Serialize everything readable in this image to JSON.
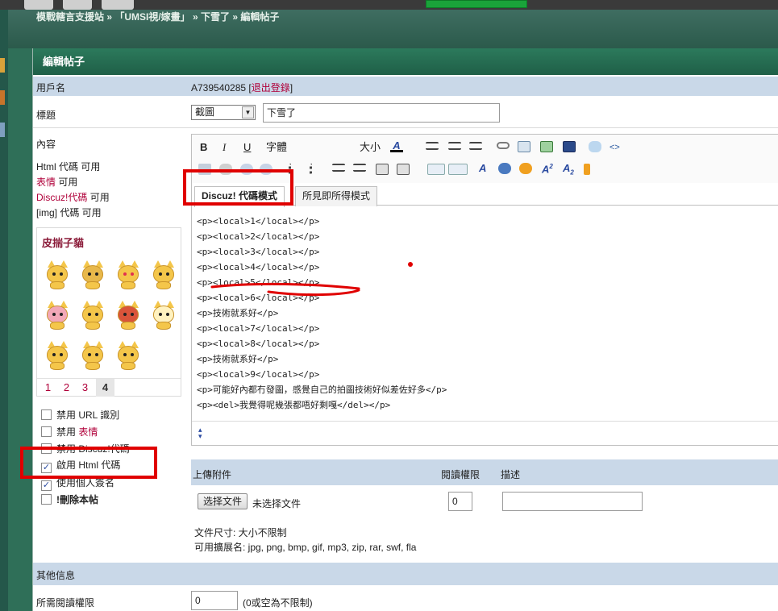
{
  "header": {
    "breadcrumb": "模戰轄言支援站 » 「UMSI視/嫁畫」 » 下雪了 » 編輯帖子"
  },
  "panel": {
    "title": "編輯帖子"
  },
  "form": {
    "username_label": "用戶名",
    "username_value": "A739540285",
    "logout_link": "退出登錄",
    "title_label": "標題",
    "title_prefix": "截圖",
    "title_value": "下雪了",
    "content_label": "內容",
    "html_status": "Html 代碼 可用",
    "smilies_link": "表情",
    "smilies_status": "可用",
    "discuz_link": "Discuz!代碼",
    "discuz_status": "可用",
    "img_status": "[img] 代碼 可用"
  },
  "emoticons": {
    "title": "皮揣子貓",
    "pages": [
      "1",
      "2",
      "3",
      "4"
    ],
    "current_page": "4"
  },
  "options": {
    "disable_url": "禁用 URL 識別",
    "disable_smilies_prefix": "禁用",
    "disable_smilies_link": "表情",
    "disable_discuz": "禁用 Discuz!代碼",
    "enable_html": "啟用 Html 代碼",
    "use_signature": "使用個人簽名",
    "delete_post": "!刪除本帖"
  },
  "editor": {
    "bold": "B",
    "italic": "I",
    "underline": "U",
    "font": "字體",
    "size": "大小",
    "font_color_glyph": "A",
    "tab_code": "Discuz! 代碼模式",
    "tab_wysiwyg": "所見即所得模式",
    "lines": [
      "<p><local>1</local></p>",
      "<p><local>2</local></p>",
      "<p><local>3</local></p>",
      "<p><local>4</local></p>",
      "<p><local>5</local></p>",
      "<p><local>6</local></p>",
      "<p>技術就系好</p>",
      "<p><local>7</local></p>",
      "<p><local>8</local></p>",
      "<p>技術就系好</p>",
      "<p><local>9</local></p>",
      "<p>可能好內都冇發圖，感覺自己的拍圖技術好似差佐好多</p>",
      "<p><del>我覺得呢幾張都唔好剩嘎</del></p>"
    ]
  },
  "upload": {
    "header_attach": "上傳附件",
    "header_permission": "閱讀權限",
    "header_desc": "描述",
    "choose_file": "选择文件",
    "no_file": "未选择文件",
    "permission_value": "0",
    "size_note": "文件尺寸: 大小不限制",
    "ext_note": "可用擴展名: jpg, png, bmp, gif, mp3, zip, rar, swf, fla"
  },
  "other": {
    "section_title": "其他信息",
    "read_perm_label": "所需閱讀權限",
    "read_perm_value": "0",
    "read_perm_note": "(0或空為不限制)"
  },
  "colors": {
    "header_green": "#1f5f47",
    "row_blue": "#c9d8e8",
    "link_red": "#b0003a",
    "annotation_red": "#e00000"
  }
}
